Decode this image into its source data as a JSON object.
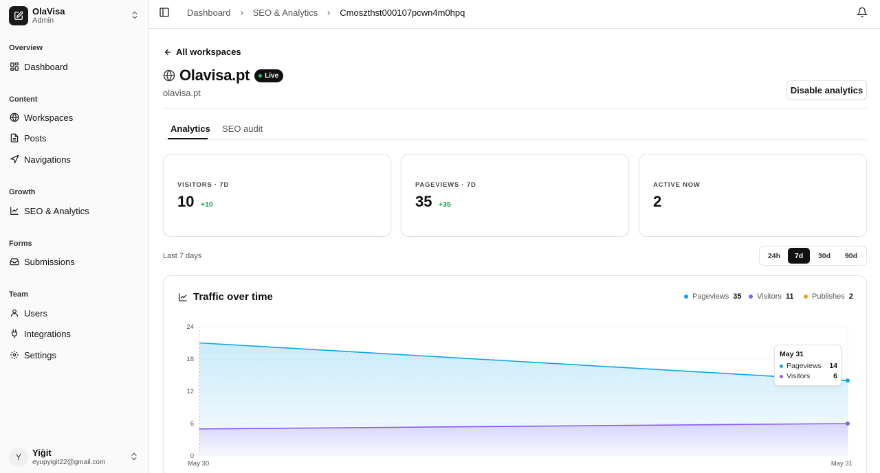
{
  "app": {
    "name": "OlaVisa",
    "role": "Admin"
  },
  "sidebar": {
    "sections": [
      {
        "label": "Overview",
        "items": [
          {
            "label": "Dashboard",
            "icon": "layout-grid-icon"
          }
        ]
      },
      {
        "label": "Content",
        "items": [
          {
            "label": "Workspaces",
            "icon": "globe-icon"
          },
          {
            "label": "Posts",
            "icon": "file-icon"
          },
          {
            "label": "Navigations",
            "icon": "send-icon"
          }
        ]
      },
      {
        "label": "Growth",
        "items": [
          {
            "label": "SEO & Analytics",
            "icon": "line-chart-icon"
          }
        ]
      },
      {
        "label": "Forms",
        "items": [
          {
            "label": "Submissions",
            "icon": "inbox-icon"
          }
        ]
      },
      {
        "label": "Team",
        "items": [
          {
            "label": "Users",
            "icon": "user-icon"
          },
          {
            "label": "Integrations",
            "icon": "plug-icon"
          },
          {
            "label": "Settings",
            "icon": "gear-icon"
          }
        ]
      }
    ]
  },
  "user": {
    "initial": "Y",
    "name": "Yiğit",
    "email": "eyupyigit22@gmail.com"
  },
  "breadcrumb": [
    "Dashboard",
    "SEO & Analytics",
    "Cmoszthst000107pcwn4m0hpq"
  ],
  "back_link": "All workspaces",
  "site": {
    "title": "Olavisa.pt",
    "badge": "Live",
    "domain": "olavisa.pt",
    "disable_label": "Disable analytics"
  },
  "tabs": [
    "Analytics",
    "SEO audit"
  ],
  "stats": [
    {
      "label": "VISITORS · 7D",
      "value": "10",
      "delta": "+10"
    },
    {
      "label": "PAGEVIEWS · 7D",
      "value": "35",
      "delta": "+35"
    },
    {
      "label": "ACTIVE NOW",
      "value": "2",
      "delta": ""
    }
  ],
  "range": {
    "note": "Last 7 days",
    "options": [
      "24h",
      "7d",
      "30d",
      "90d"
    ],
    "selected": "7d"
  },
  "chart": {
    "title": "Traffic over time",
    "legend": [
      {
        "name": "Pageviews",
        "value": "35",
        "color": "#0ea5e9"
      },
      {
        "name": "Visitors",
        "value": "11",
        "color": "#8b5cf6"
      },
      {
        "name": "Publishes",
        "value": "2",
        "color": "#f59e0b"
      }
    ],
    "tooltip": {
      "title": "May 31",
      "rows": [
        {
          "name": "Pageviews",
          "value": "14",
          "color": "#0ea5e9"
        },
        {
          "name": "Visitors",
          "value": "6",
          "color": "#8b5cf6"
        }
      ]
    }
  },
  "chart_data": {
    "type": "area",
    "x": [
      "May 30",
      "May 31"
    ],
    "ylim": [
      0,
      24
    ],
    "yticks": [
      "0",
      "6",
      "12",
      "18",
      "24"
    ],
    "grid": true,
    "series": [
      {
        "name": "Pageviews",
        "values": [
          21,
          14
        ],
        "color": "#0ea5e9"
      },
      {
        "name": "Visitors",
        "values": [
          5,
          6
        ],
        "color": "#8b5cf6"
      }
    ]
  }
}
